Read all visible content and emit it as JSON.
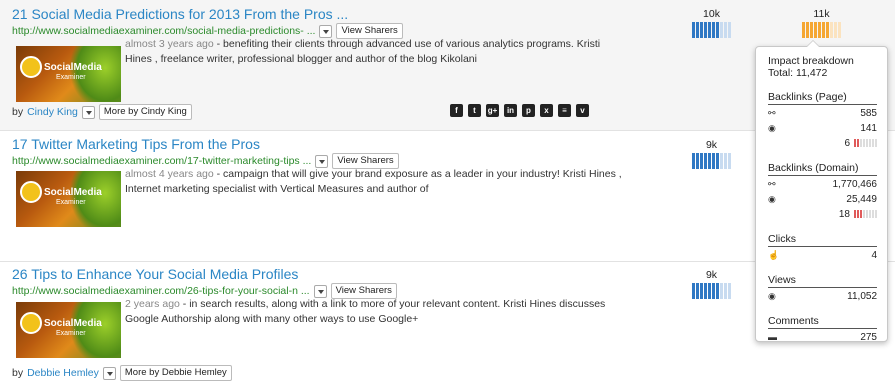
{
  "results": [
    {
      "title": "21 Social Media Predictions for 2013 From the Pros ...",
      "url": "http://www.socialmediaexaminer.com/social-media-predictions- ...",
      "view_sharers": "View Sharers",
      "meta": "almost 3 years ago",
      "snippet": " - benefiting their clients through advanced use of various analytics programs. Kristi Hines , freelance writer, professional blogger and author of the blog Kikolani",
      "by_label": "by",
      "author": "Cindy King",
      "more_by": "More by Cindy King",
      "metric1": "10k",
      "metric2": "11k"
    },
    {
      "title": "17 Twitter Marketing Tips From the Pros",
      "url": "http://www.socialmediaexaminer.com/17-twitter-marketing-tips ...",
      "view_sharers": "View Sharers",
      "meta": "almost 4 years ago",
      "snippet": " - campaign that will give your brand exposure as a leader in your industry! Kristi Hines , Internet marketing specialist with Vertical Measures and author of",
      "metric1": "9k"
    },
    {
      "title": "26 Tips to Enhance Your Social Media Profiles",
      "url": "http://www.socialmediaexaminer.com/26-tips-for-your-social-n ...",
      "view_sharers": "View Sharers",
      "meta": "2 years ago",
      "snippet": " - in search results, along with a link to more of your relevant content. Kristi Hines discusses Google Authorship along with many other ways to use Google+",
      "by_label": "by",
      "author": "Debbie Hemley",
      "more_by": "More by Debbie Hemley",
      "metric1": "9k"
    }
  ],
  "thumbnail": {
    "logo_text": "SocialMedia",
    "logo_sub": "Examiner"
  },
  "social_icons": [
    "facebook-icon",
    "twitter-icon",
    "google-plus-icon",
    "linkedin-icon",
    "pinterest-icon",
    "xing-icon",
    "buffer-icon",
    "pocket-icon"
  ],
  "popup": {
    "title": "Impact breakdown",
    "total": "Total: 11,472",
    "backlinks_page": {
      "label": "Backlinks (Page)",
      "links": "585",
      "pages": "141",
      "other": "6"
    },
    "backlinks_domain": {
      "label": "Backlinks (Domain)",
      "links": "1,770,466",
      "pages": "25,449",
      "other": "18"
    },
    "clicks": {
      "label": "Clicks",
      "value": "4"
    },
    "views": {
      "label": "Views",
      "value": "11,052"
    },
    "comments": {
      "label": "Comments",
      "value": "275"
    }
  },
  "colors": {
    "title_link": "#2b86c5",
    "url": "#2b8a2b",
    "bar_blue": "#2f78c4",
    "bar_orange": "#f5a733"
  }
}
